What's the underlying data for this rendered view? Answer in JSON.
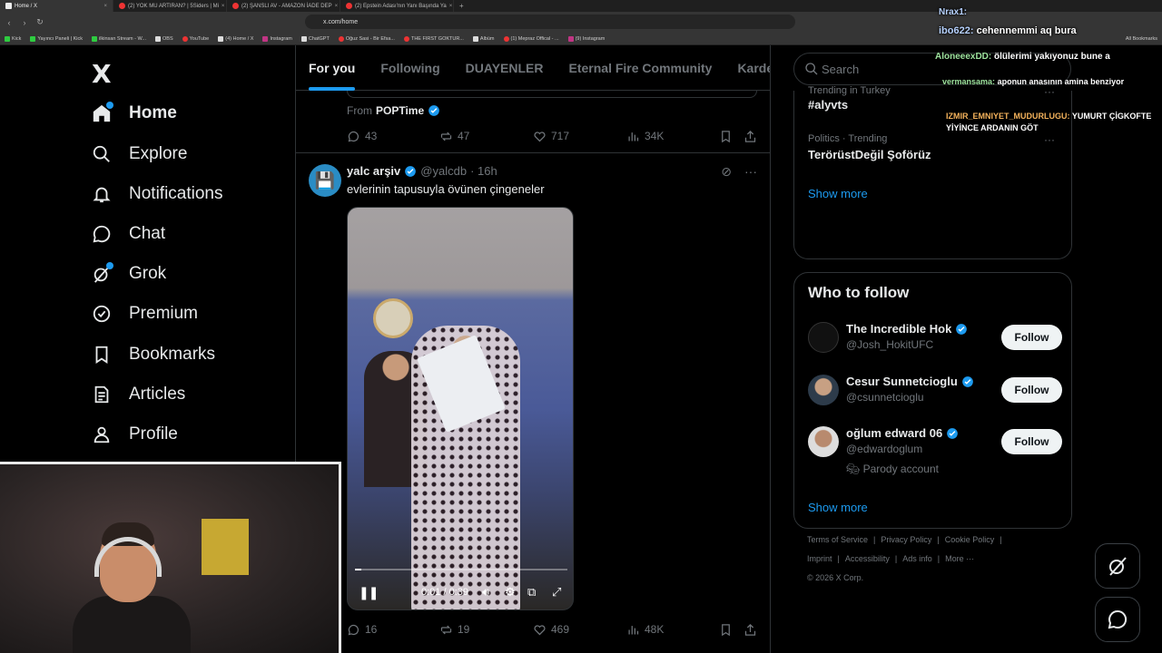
{
  "browser": {
    "tabs": [
      {
        "title": "Home / X",
        "active": true
      },
      {
        "title": "(2) YOK MU ARTIRAN? | 5Siders | Mi"
      },
      {
        "title": "(2) ŞANSLI AV - AMAZON İADE DEP"
      },
      {
        "title": "(2) Epstein Adası'nın Yanı Başında Ya"
      }
    ],
    "url": "x.com/home",
    "bookmarks": [
      "Kick",
      "Yayıncı Paneli | Kick",
      "ilkinsan Stream - W...",
      "OBS",
      "YouTube",
      "(4) Home / X",
      "Instagram",
      "ChatGPT",
      "Oğuz Sasi - Bir Efsa...",
      "THE FIRST GOKTUR...",
      "Albüm",
      "(1) Mepraz Offical - ...",
      "(9) Instagram"
    ],
    "all_bookmarks": "All Bookmarks"
  },
  "sidebar": {
    "logo": "X",
    "items": [
      {
        "label": "Home",
        "icon": "home-icon"
      },
      {
        "label": "Explore",
        "icon": "search-icon"
      },
      {
        "label": "Notifications",
        "icon": "bell-icon"
      },
      {
        "label": "Chat",
        "icon": "chat-icon"
      },
      {
        "label": "Grok",
        "icon": "grok-icon"
      },
      {
        "label": "Premium",
        "icon": "premium-icon"
      },
      {
        "label": "Bookmarks",
        "icon": "bookmark-icon"
      },
      {
        "label": "Articles",
        "icon": "articles-icon"
      },
      {
        "label": "Profile",
        "icon": "profile-icon"
      }
    ]
  },
  "feed": {
    "tabs": [
      "For you",
      "Following",
      "DUAYENLER",
      "Eternal Fire Community",
      "Kardeşler Kı"
    ],
    "prev_post": {
      "from_label": "From",
      "from_name": "POPTime",
      "replies": "43",
      "reposts": "47",
      "likes": "717",
      "views": "34K"
    },
    "post": {
      "name": "yalc arşiv",
      "handle": "@yalcdb",
      "time": "· 16h",
      "text": "evlerinin tapusuyla övünen çingeneler",
      "video": {
        "time": "0:01 / 0:39",
        "progress": 0.03
      },
      "replies": "16",
      "reposts": "19",
      "likes": "469",
      "views": "48K"
    }
  },
  "right": {
    "search_placeholder": "Search",
    "trends": [
      {
        "context": "Trending in Turkey",
        "title": "#alyvts"
      },
      {
        "context": "Politics · Trending",
        "title": "TerörüstDeğil Şoförüz"
      }
    ],
    "show_more": "Show more",
    "who_to_follow": {
      "title": "Who to follow",
      "users": [
        {
          "name": "The Incredible Hok",
          "handle": "@Josh_HokitUFC",
          "button": "Follow"
        },
        {
          "name": "Cesur Sunnetcioglu",
          "handle": "@csunnetcioglu",
          "button": "Follow"
        },
        {
          "name": "oğlum edward 06",
          "handle": "@edwardoglum",
          "note": "Parody account",
          "button": "Follow"
        }
      ],
      "show_more": "Show more"
    },
    "footer": {
      "links": [
        "Terms of Service",
        "|",
        "Privacy Policy",
        "|",
        "Cookie Policy",
        "|",
        "Imprint",
        "|",
        "Accessibility",
        "|",
        "Ads info",
        "|",
        "More ···"
      ],
      "copyright": "© 2026 X Corp."
    }
  },
  "chat_overlay": [
    {
      "user": "Nrax1:",
      "msg": ""
    },
    {
      "user": "ibo622:",
      "msg": "cehennemmi aq bura"
    },
    {
      "user": "AloneeexDD:",
      "msg": "ölülerimi yakıyonuz bune a"
    },
    {
      "user": "vermansama:",
      "msg": "aponun anasının amina benziyor"
    },
    {
      "user": "IZMIR_EMNIYET_MUDURLUGU:",
      "msg": "YUMURT ÇİGKOFTE YİYİNCE ARDANIN GÖT"
    }
  ],
  "colors": {
    "accent": "#1d9bf0",
    "background": "#000000",
    "text": "#e7e9ea",
    "muted": "#71767b",
    "border": "#2f3336"
  }
}
